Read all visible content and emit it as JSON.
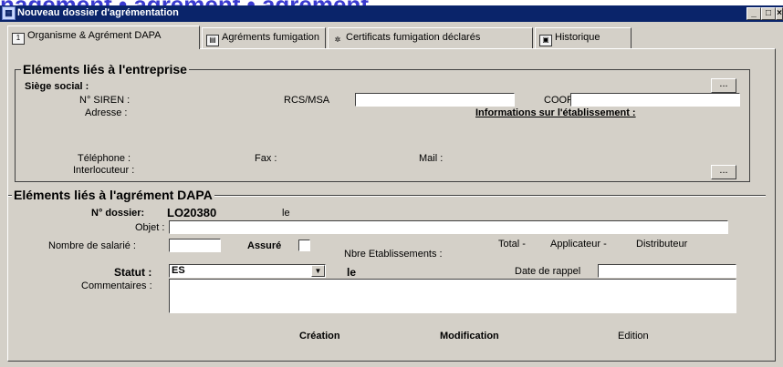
{
  "banner": "nagement • agrément • agrément",
  "window": {
    "title": "Nouveau dossier d'agrémentation",
    "minimize": "_",
    "maximize": "□",
    "close": "×"
  },
  "tabs": [
    {
      "label": "Organisme & Agrément DAPA",
      "icon": "doc-1-icon",
      "active": true
    },
    {
      "label": "Agréments fumigation",
      "icon": "copy-docs-icon"
    },
    {
      "label": "Certificats fumigation déclarés",
      "icon": "certificate-icon"
    },
    {
      "label": "Historique",
      "icon": "history-icon"
    }
  ],
  "entreprise": {
    "title": "Eléments liés à l'entreprise",
    "siege_label": "Siège social :",
    "siren_label": "N° SIREN :",
    "rcs_label": "RCS/MSA",
    "rcs_value": "",
    "coop_label": "COOP",
    "coop_value": "",
    "adresse_label": "Adresse :",
    "info_etab_label": "Informations sur l'établissement :",
    "telephone_label": "Téléphone :",
    "fax_label": "Fax :",
    "mail_label": "Mail :",
    "interlocuteur_label": "Interlocuteur :",
    "ellipsis": "..."
  },
  "agrement": {
    "title": "Eléments liés à l'agrément DAPA",
    "dossier_label": "N° dossier:",
    "dossier_value": "LO20380",
    "le_label": "le",
    "objet_label": "Objet :",
    "objet_value": "",
    "nb_salarie_label": "Nombre de salarié :",
    "nb_salarie_value": "",
    "assure_label": "Assuré",
    "nbre_etab_label": "Nbre Etablissements :",
    "total_label": "Total -",
    "applicateur_label": "Applicateur -",
    "distributeur_label": "Distributeur",
    "statut_label": "Statut :",
    "statut_value": "ES",
    "le2_label": "le",
    "date_rappel_label": "Date de rappel",
    "date_rappel_value": "",
    "commentaires_label": "Commentaires :",
    "commentaires_value": "",
    "creation_label": "Création",
    "modification_label": "Modification",
    "edition_label": "Edition"
  }
}
